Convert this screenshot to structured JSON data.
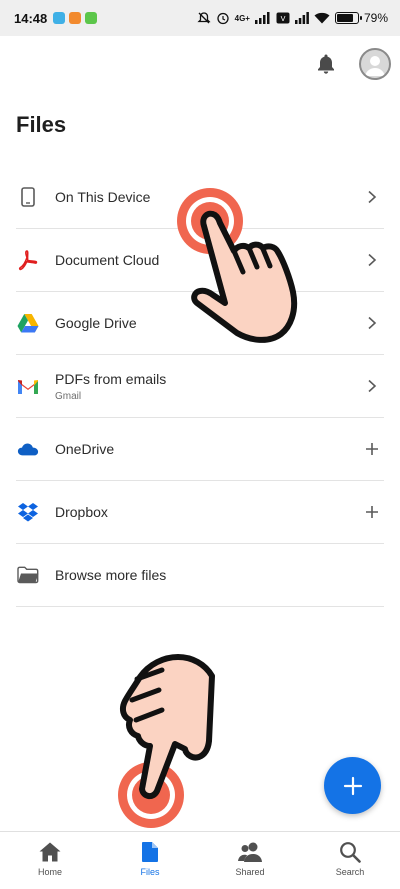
{
  "status_bar": {
    "time": "14:48",
    "network": "4G+",
    "battery_percent": 79,
    "battery_label": "79"
  },
  "app_bar": {
    "notifications_icon": "bell-icon",
    "profile_icon": "avatar-icon"
  },
  "page": {
    "title": "Files"
  },
  "locations": [
    {
      "label": "On This Device",
      "sublabel": "",
      "icon": "phone-icon",
      "trailing": "chevron"
    },
    {
      "label": "Document Cloud",
      "sublabel": "",
      "icon": "acrobat-icon",
      "trailing": "chevron"
    },
    {
      "label": "Google Drive",
      "sublabel": "",
      "icon": "google-drive-icon",
      "trailing": "chevron"
    },
    {
      "label": "PDFs from emails",
      "sublabel": "Gmail",
      "icon": "gmail-icon",
      "trailing": "chevron"
    },
    {
      "label": "OneDrive",
      "sublabel": "",
      "icon": "onedrive-icon",
      "trailing": "plus"
    },
    {
      "label": "Dropbox",
      "sublabel": "",
      "icon": "dropbox-icon",
      "trailing": "plus"
    },
    {
      "label": "Browse more files",
      "sublabel": "",
      "icon": "folder-icon",
      "trailing": "none"
    }
  ],
  "fab": {
    "icon": "plus-icon"
  },
  "bottom_nav": [
    {
      "label": "Home",
      "icon": "home-icon",
      "active": false
    },
    {
      "label": "Files",
      "icon": "file-icon",
      "active": true
    },
    {
      "label": "Shared",
      "icon": "shared-people-icon",
      "active": false
    },
    {
      "label": "Search",
      "icon": "search-icon",
      "active": false
    }
  ],
  "colors": {
    "accent": "#1473e6",
    "status_bar_bg": "#efefef",
    "gesture_ring": "#f0664f",
    "gesture_hand": "#fbd3c2"
  }
}
